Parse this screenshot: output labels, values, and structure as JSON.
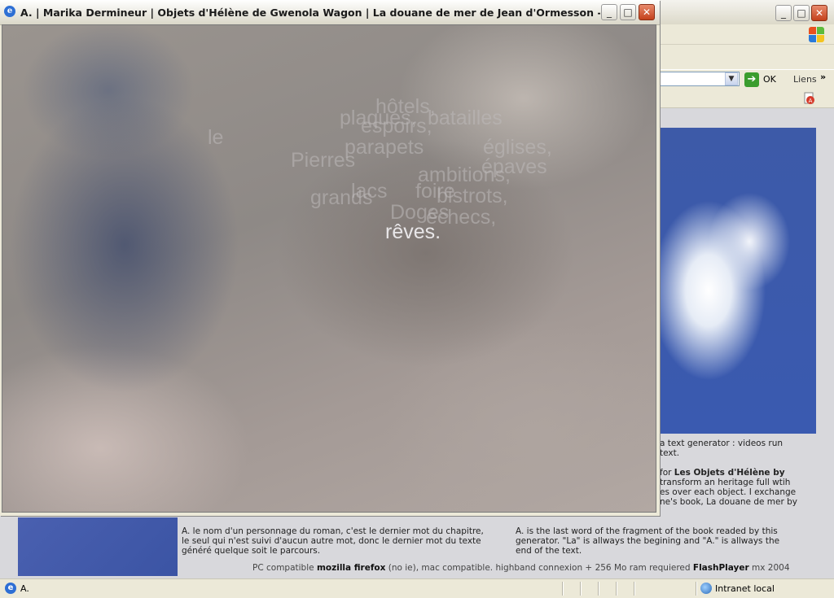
{
  "background_window": {
    "address_go_label": "OK",
    "links_label": "Liens",
    "links_chevron": "»",
    "statusbar": {
      "text": "A.",
      "zone": "Intranet local"
    }
  },
  "background_page": {
    "right_column": {
      "line1": "a text generator : videos run",
      "line2": "text.",
      "line3_pre": "for ",
      "line3_bold": "Les Objets d'Hélène by",
      "line4": "transform an heritage full wtih",
      "line5": "es over each object. I exchange",
      "line6": "ne's book, La douane de mer by"
    },
    "footer": {
      "fr_lines": [
        "A. le nom d'un personnage du roman, c'est le dernier mot du chapitre,",
        "le seul qui n'est suivi d'aucun autre mot, donc le dernier mot du texte",
        "généré quelque soit le parcours."
      ],
      "en_lines": [
        "A. is the last word of the fragment of the book readed by this",
        "generator. \"La\" is allways the begining and \"A.\" is allways the",
        "end of the text."
      ],
      "compat": {
        "pre": "PC compatible ",
        "firefox": "mozilla firefox",
        "mid": " (no ie), mac compatible. highband connexion + 256 Mo ram requiered ",
        "flash": "FlashPlayer",
        "post": " mx 2004"
      }
    }
  },
  "popup": {
    "title": "A. | Marika Dermineur | Objets d'Hélène de Gwenola Wagon | La douane de mer de Jean d'Ormesson - Microsoft...",
    "buttons": {
      "minimize": "_",
      "maximize": "□",
      "close": "✕"
    },
    "words": {
      "hotels": "hôtels,",
      "plaques": "plaques,",
      "batailles": "batailles",
      "espoirs": "espoirs,",
      "le": "le",
      "parapets": "parapets",
      "eglises": "églises,",
      "pierres": "Pierres",
      "ambitions": "ambitions,",
      "epaves": "épaves",
      "lacs": "lacs",
      "foire": "foire",
      "grands": "grands",
      "bistrots": "bistrots,",
      "doges": "Doges",
      "echecs": "échecs,",
      "reves": "rêves."
    }
  },
  "colors": {
    "popup_focus_word": "#e8e6e8",
    "popup_faded_word": "rgba(190,185,185,0.55)",
    "close_button": "#c4411c",
    "go_arrow": "#3a9d2e"
  },
  "icons": {
    "popup_title": "ie-icon",
    "status": "ie-icon",
    "zone": "intranet-globe-icon",
    "brand": "windows-flag-icon"
  }
}
